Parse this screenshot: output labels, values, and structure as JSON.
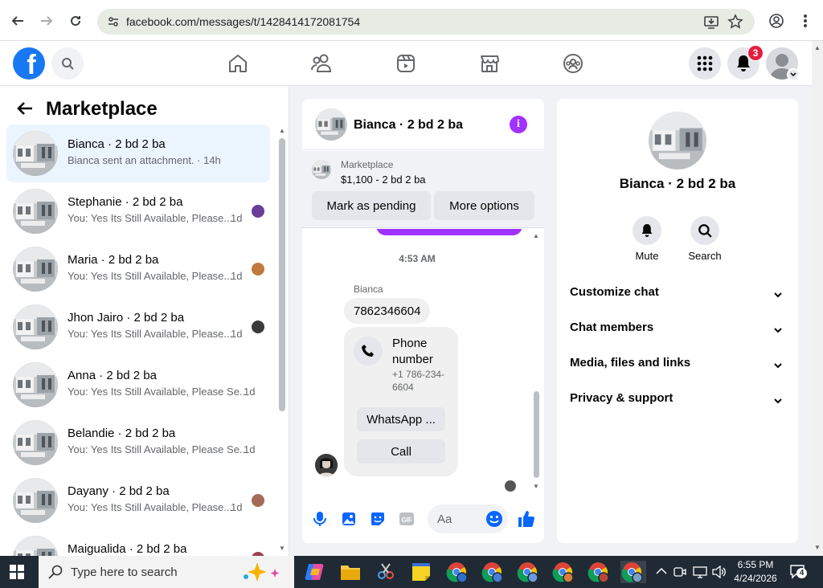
{
  "browser": {
    "url": "facebook.com/messages/t/1428414172081754"
  },
  "header": {
    "logo": "f",
    "notification_count": "3"
  },
  "left_pane": {
    "title": "Marketplace",
    "conversations": [
      {
        "name": "Bianca · 2 bd 2 ba",
        "preview": "Bianca sent an attachment. · 14h",
        "time": "",
        "active": true
      },
      {
        "name": "Stephanie · 2 bd 2 ba",
        "preview": "You: Yes Its Still Available, Please...",
        "time": "1d"
      },
      {
        "name": "Maria · 2 bd 2 ba",
        "preview": "You: Yes Its Still Available, Please...",
        "time": "1d"
      },
      {
        "name": "Jhon Jairo · 2 bd 2 ba",
        "preview": "You: Yes Its Still Available, Please...",
        "time": "1d"
      },
      {
        "name": "Anna · 2 bd 2 ba",
        "preview": "You: Yes Its Still Available, Please Se...",
        "time": "1d"
      },
      {
        "name": "Belandie · 2 bd 2 ba",
        "preview": "You: Yes Its Still Available, Please Se...",
        "time": "1d"
      },
      {
        "name": "Dayany · 2 bd 2 ba",
        "preview": "You: Yes Its Still Available, Please...",
        "time": "1d"
      },
      {
        "name": "Maigualida · 2 bd 2 ba",
        "preview": "",
        "time": ""
      }
    ]
  },
  "chat": {
    "title": "Bianca · 2 bd 2 ba",
    "marketplace_label": "Marketplace",
    "listing": "$1,100 - 2 bd 2 ba",
    "mark_pending": "Mark as pending",
    "more_options": "More options",
    "time_separator": "4:53 AM",
    "sender": "Bianca",
    "message": "7862346604",
    "card_title": "Phone number",
    "card_phone": "+1 786-234-6604",
    "whatsapp_btn": "WhatsApp ...",
    "call_btn": "Call",
    "composer_placeholder": "Aa"
  },
  "info": {
    "name": "Bianca · 2 bd 2 ba",
    "mute": "Mute",
    "search": "Search",
    "sections": [
      "Customize chat",
      "Chat members",
      "Media, files and links",
      "Privacy & support"
    ]
  },
  "taskbar": {
    "search_placeholder": "Type here to search",
    "time": "6:55 PM",
    "date": "4/24/2026",
    "notif_count": "4"
  }
}
